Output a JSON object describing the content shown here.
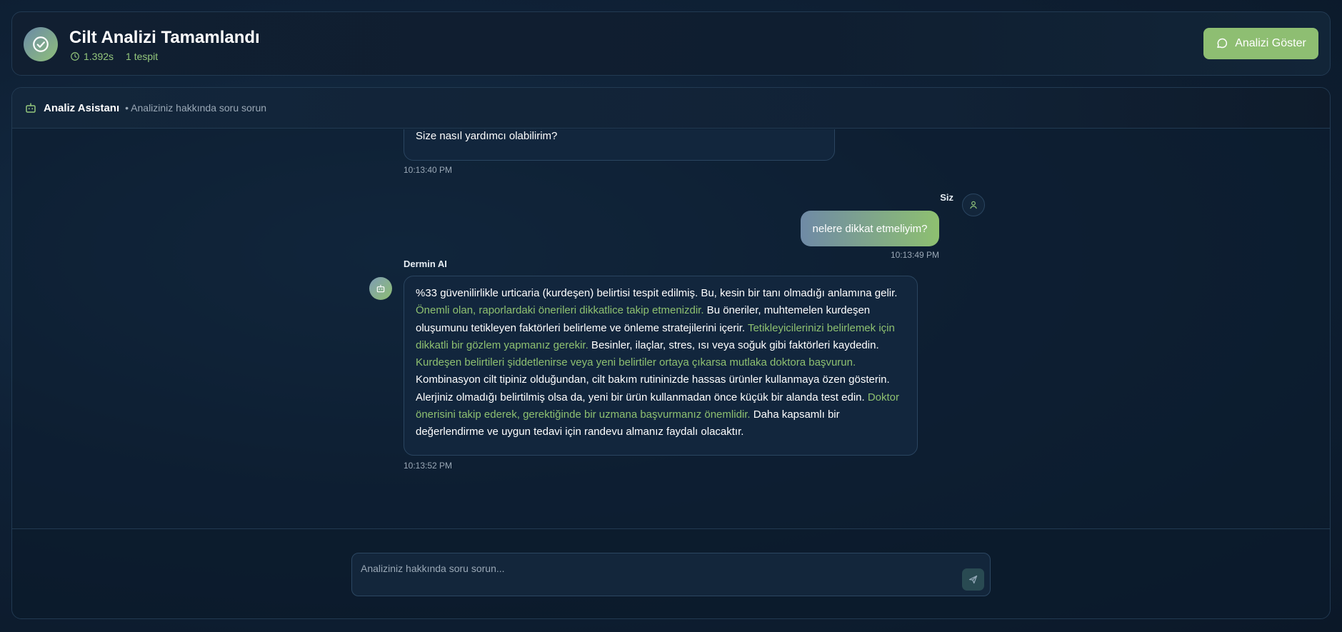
{
  "header": {
    "title": "Cilt Analizi Tamamlandı",
    "duration": "1.392s",
    "findings": "1 tespit",
    "show_button_label": "Analizi Göster"
  },
  "assistant": {
    "name": "Analiz Asistanı",
    "subtitle": "• Analiziniz hakkında soru sorun"
  },
  "messages": [
    {
      "role": "assistant",
      "text": "Size nasıl yardımcı olabilirim?",
      "time": "10:13:40 PM"
    },
    {
      "role": "user",
      "sender": "Siz",
      "text": "nelere dikkat etmeliyim?",
      "time": "10:13:49 PM"
    },
    {
      "role": "assistant",
      "sender": "Dermin AI",
      "time": "10:13:52 PM",
      "segments": [
        {
          "text": "%33 güvenilirlikle urticaria (kurdeşen) belirtisi tespit edilmiş. Bu, kesin bir tanı olmadığı anlamına gelir. ",
          "highlight": false
        },
        {
          "text": "Önemli olan, raporlardaki önerileri dikkatlice takip etmenizdir.",
          "highlight": true
        },
        {
          "text": " Bu öneriler, muhtemelen kurdeşen oluşumunu tetikleyen faktörleri belirleme ve önleme stratejilerini içerir. ",
          "highlight": false
        },
        {
          "text": "Tetikleyicilerinizi belirlemek için dikkatli bir gözlem yapmanız gerekir.",
          "highlight": true
        },
        {
          "text": " Besinler, ilaçlar, stres, ısı veya soğuk gibi faktörleri kaydedin. ",
          "highlight": false
        },
        {
          "text": "Kurdeşen belirtileri şiddetlenirse veya yeni belirtiler ortaya çıkarsa mutlaka doktora başvurun.",
          "highlight": true
        },
        {
          "text": " Kombinasyon cilt tipiniz olduğundan, cilt bakım rutininizde hassas ürünler kullanmaya özen gösterin. Alerjiniz olmadığı belirtilmiş olsa da, yeni bir ürün kullanmadan önce küçük bir alanda test edin. ",
          "highlight": false
        },
        {
          "text": "Doktor önerisini takip ederek, gerektiğinde bir uzmana başvurmanız önemlidir.",
          "highlight": true
        },
        {
          "text": " Daha kapsamlı bir değerlendirme ve uygun tedavi için randevu almanız faydalı olacaktır.",
          "highlight": false
        }
      ]
    }
  ],
  "composer": {
    "placeholder": "Analiziniz hakkında soru sorun..."
  },
  "colors": {
    "accent": "#8ec070",
    "background": "#0f2136",
    "bubble": "#12263d"
  },
  "icons": [
    "check-circle-icon",
    "clock-icon",
    "chat-bubble-icon",
    "robot-icon",
    "user-icon",
    "send-icon"
  ]
}
